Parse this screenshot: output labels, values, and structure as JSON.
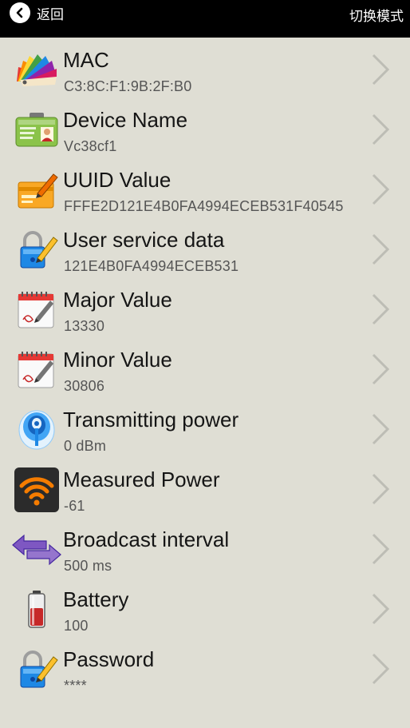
{
  "topbar": {
    "back_label": "返回",
    "switch_label": "切换模式"
  },
  "items": [
    {
      "title": "MAC",
      "value": "C3:8C:F1:9B:2F:B0",
      "icon": "color-fan-icon"
    },
    {
      "title": "Device Name",
      "value": "Vc38cf1",
      "icon": "id-card-icon"
    },
    {
      "title": "UUID Value",
      "value": "FFFE2D121E4B0FA4994ECEB531F40545",
      "icon": "card-pen-icon"
    },
    {
      "title": "User service data",
      "value": "121E4B0FA4994ECEB531",
      "icon": "lock-pen-icon"
    },
    {
      "title": "Major Value",
      "value": "13330",
      "icon": "calendar-pen-icon"
    },
    {
      "title": "Minor Value",
      "value": "30806",
      "icon": "calendar-pen-icon"
    },
    {
      "title": "Transmitting power",
      "value": "0 dBm",
      "icon": "beacon-icon"
    },
    {
      "title": "Measured Power",
      "value": "-61",
      "icon": "wifi-icon"
    },
    {
      "title": "Broadcast interval",
      "value": "500 ms",
      "icon": "double-arrow-icon"
    },
    {
      "title": "Battery",
      "value": "100",
      "icon": "battery-icon"
    },
    {
      "title": "Password",
      "value": "****",
      "icon": "lock-pen-icon"
    }
  ],
  "colors": {
    "background": "#dfded4",
    "topbar": "#000000",
    "chevron": "#bdbdb5"
  }
}
